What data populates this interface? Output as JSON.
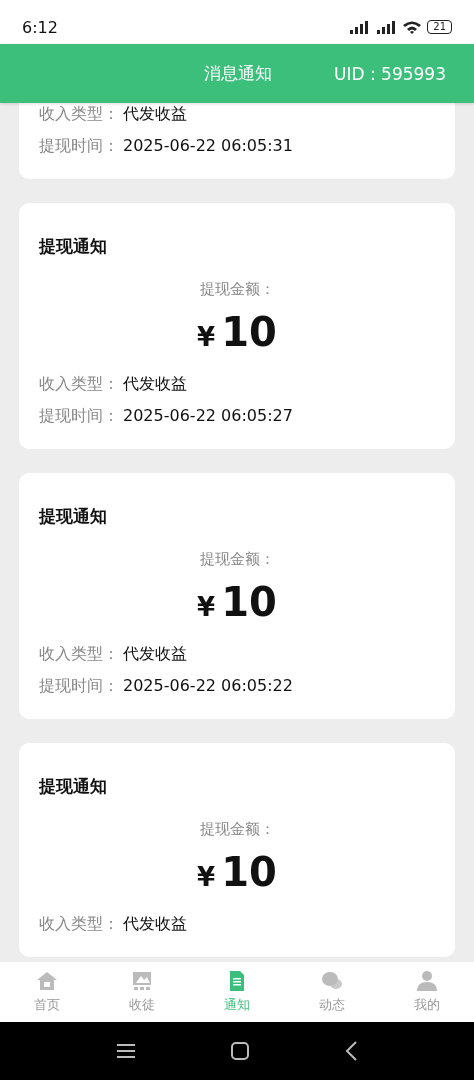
{
  "status_bar": {
    "time": "6:12",
    "battery": "21"
  },
  "header": {
    "title": "消息通知",
    "uid": "UID : 595993"
  },
  "notifications": [
    {
      "kind": "partial",
      "rows": [
        {
          "label": "收入类型：",
          "value": "代发收益"
        },
        {
          "label": "提现时间：",
          "value": "2025-06-22 06:05:31"
        }
      ]
    },
    {
      "kind": "full",
      "title": "提现通知",
      "amount_label": "提现金额：",
      "currency": "¥",
      "amount": "10",
      "rows": [
        {
          "label": "收入类型：",
          "value": "代发收益"
        },
        {
          "label": "提现时间：",
          "value": "2025-06-22 06:05:27"
        }
      ]
    },
    {
      "kind": "full",
      "title": "提现通知",
      "amount_label": "提现金额：",
      "currency": "¥",
      "amount": "10",
      "rows": [
        {
          "label": "收入类型：",
          "value": "代发收益"
        },
        {
          "label": "提现时间：",
          "value": "2025-06-22 06:05:22"
        }
      ]
    },
    {
      "kind": "full",
      "title": "提现通知",
      "amount_label": "提现金额：",
      "currency": "¥",
      "amount": "10",
      "rows": [
        {
          "label": "收入类型：",
          "value": "代发收益"
        }
      ]
    }
  ],
  "tabs": [
    {
      "label": "首页",
      "selected": false
    },
    {
      "label": "收徒",
      "selected": false
    },
    {
      "label": "通知",
      "selected": true
    },
    {
      "label": "动态",
      "selected": false
    },
    {
      "label": "我的",
      "selected": false
    }
  ]
}
